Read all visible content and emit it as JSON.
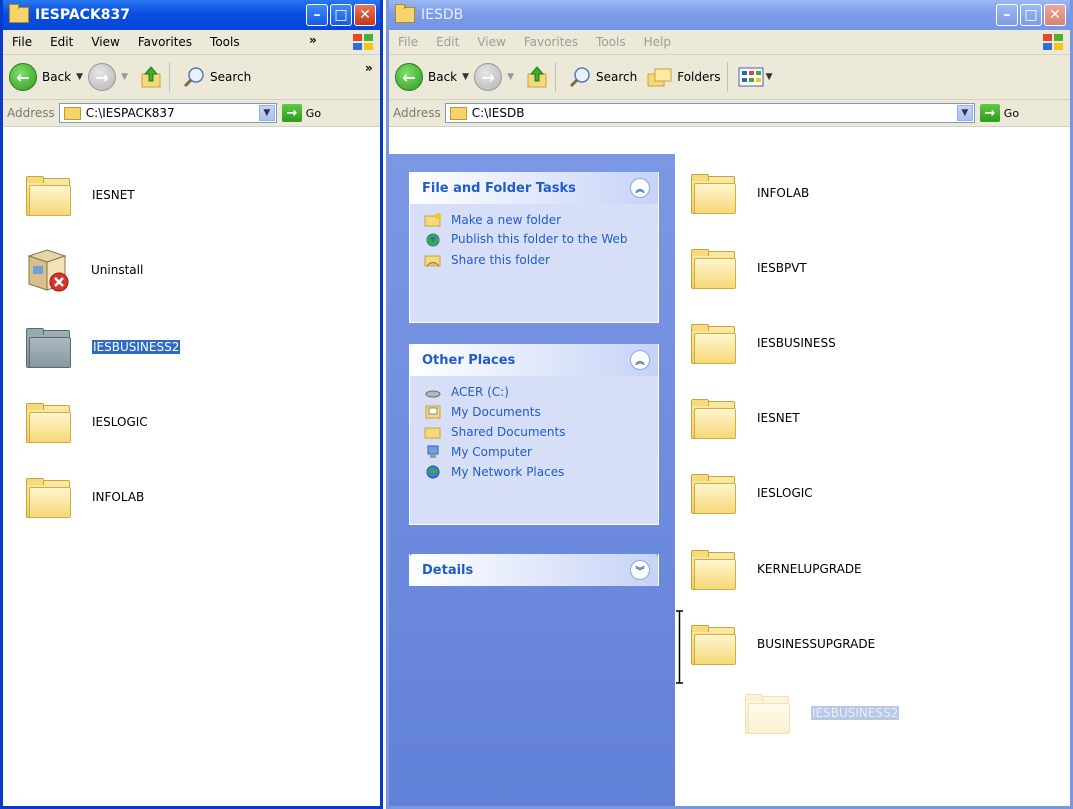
{
  "left_window": {
    "title": "IESPACK837",
    "menu": [
      "File",
      "Edit",
      "View",
      "Favorites",
      "Tools"
    ],
    "menu_more": "»",
    "toolbar": {
      "back": "Back",
      "search": "Search",
      "more": "»"
    },
    "address": {
      "label": "Address",
      "path": "C:\\IESPACK837",
      "go": "Go"
    },
    "items": [
      {
        "name": "IESNET",
        "type": "folder",
        "selected": false
      },
      {
        "name": "Uninstall",
        "type": "installer",
        "selected": false
      },
      {
        "name": "IESBUSINESS2",
        "type": "folder",
        "selected": true
      },
      {
        "name": "IESLOGIC",
        "type": "folder",
        "selected": false
      },
      {
        "name": "INFOLAB",
        "type": "folder",
        "selected": false
      }
    ]
  },
  "right_window": {
    "title": "IESDB",
    "menu": [
      "File",
      "Edit",
      "View",
      "Favorites",
      "Tools",
      "Help"
    ],
    "toolbar": {
      "back": "Back",
      "search": "Search",
      "folders": "Folders"
    },
    "address": {
      "label": "Address",
      "path": "C:\\IESDB",
      "go": "Go"
    },
    "tasks": {
      "file_folder": {
        "title": "File and Folder Tasks",
        "links": [
          "Make a new folder",
          "Publish this folder to the Web",
          "Share this folder"
        ]
      },
      "other_places": {
        "title": "Other Places",
        "links": [
          "ACER (C:)",
          "My Documents",
          "Shared Documents",
          "My Computer",
          "My Network Places"
        ]
      },
      "details": {
        "title": "Details"
      }
    },
    "items": [
      {
        "name": "INFOLAB"
      },
      {
        "name": "IESBPVT"
      },
      {
        "name": "IESBUSINESS"
      },
      {
        "name": "IESNET"
      },
      {
        "name": "IESLOGIC"
      },
      {
        "name": "KERNELUPGRADE"
      },
      {
        "name": "BUSINESSUPGRADE"
      }
    ],
    "drag_ghost": {
      "name": "IESBUSINESS2"
    }
  },
  "colors": {
    "xp_blue": "#0a4ee0",
    "task_pane": "#6f8ee0",
    "link_blue": "#215dc6",
    "selection": "#316ac5"
  }
}
